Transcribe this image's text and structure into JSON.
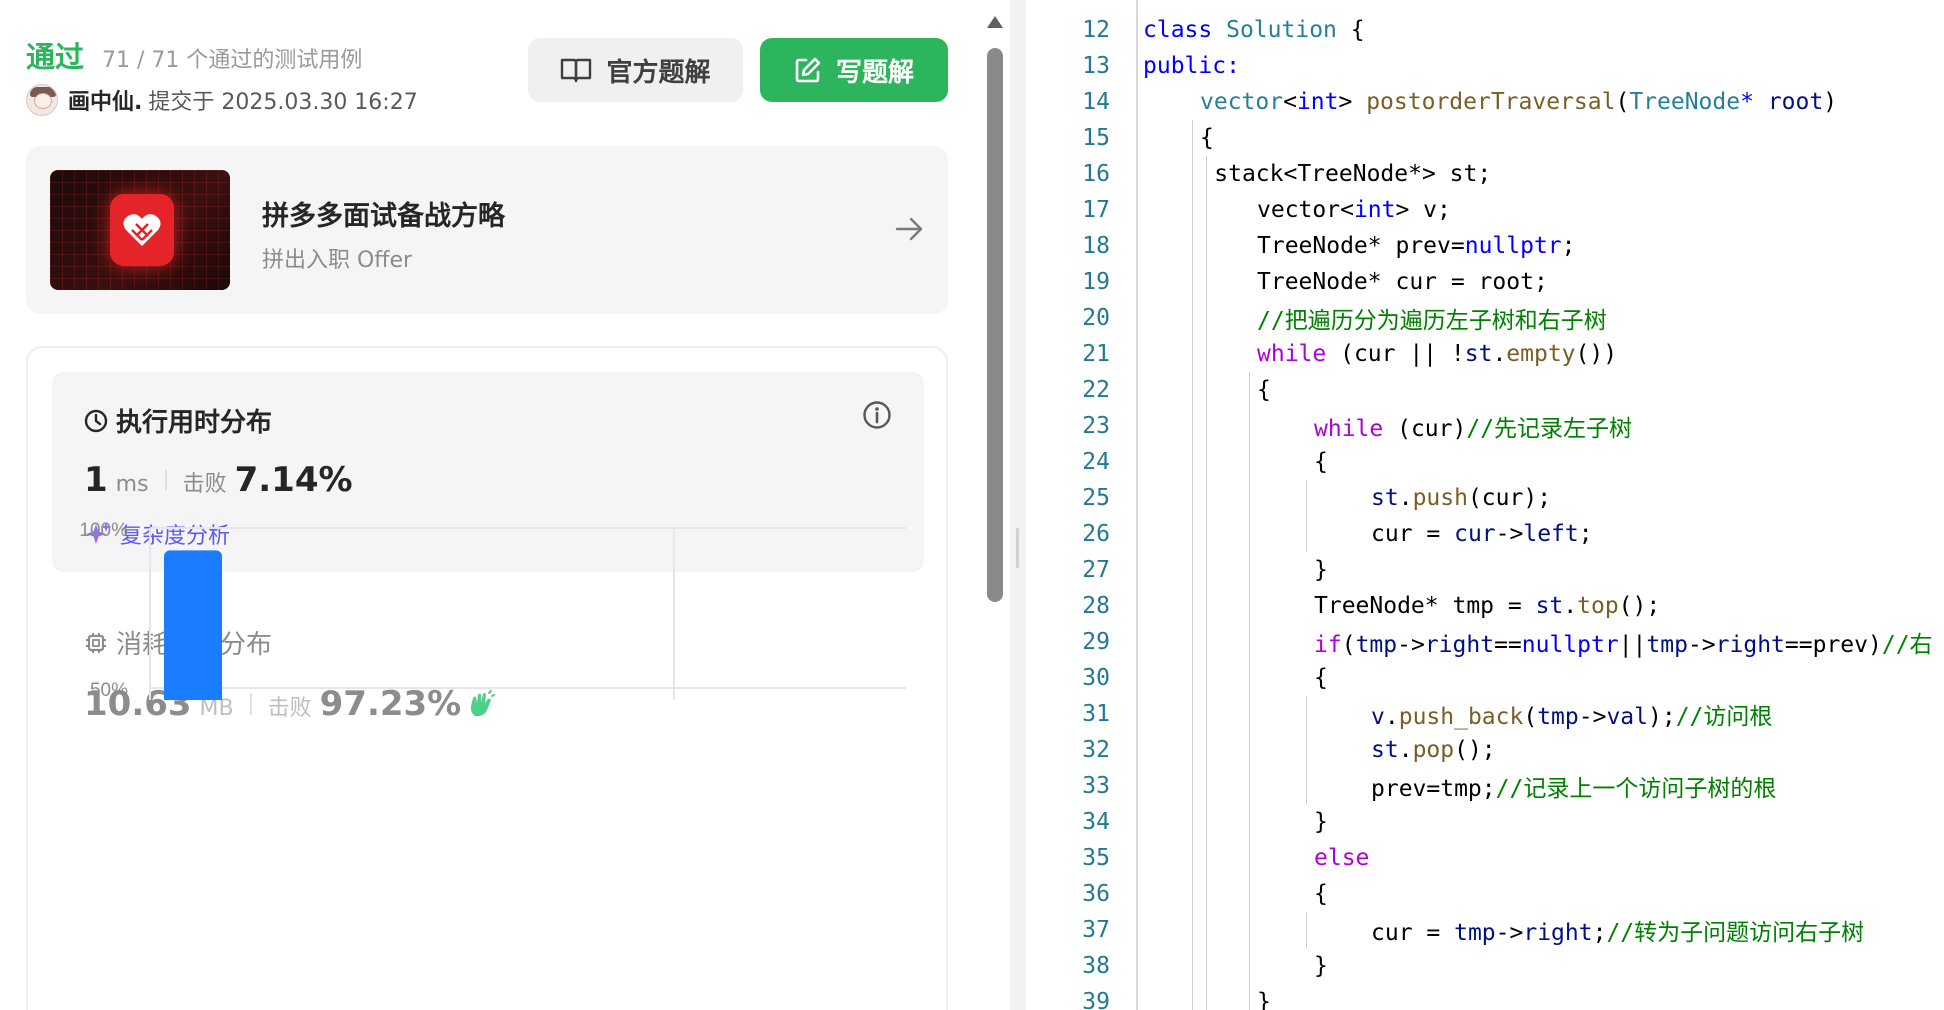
{
  "submission": {
    "status": "通过",
    "tests_passed": "71 / 71 个通过的测试用例",
    "username": "画中仙.",
    "submitted_at": "提交于 2025.03.30 16:27"
  },
  "buttons": {
    "official_solution": "官方题解",
    "write_solution": "写题解"
  },
  "banner": {
    "title": "拼多多面试备战方略",
    "subtitle": "拼出入职 Offer"
  },
  "runtime": {
    "title": "执行用时分布",
    "value": "1",
    "unit": "ms",
    "beat_label": "击败",
    "beat_pct": "7.14%",
    "complexity_link": "复杂度分析"
  },
  "memory": {
    "title": "消耗内存分布",
    "value": "10.63",
    "unit": "MB",
    "beat_label": "击败",
    "beat_pct": "97.23%"
  },
  "chart_data": {
    "type": "bar",
    "y_tick_labels": [
      "100%",
      "50%"
    ],
    "ylim": [
      50,
      100
    ],
    "grid": true,
    "values": [
      93
    ]
  },
  "colors": {
    "accent_green": "#2db55d",
    "bar_blue": "#1a7dff",
    "link_purple": "#5b5bf0"
  },
  "editor": {
    "lines": [
      {
        "n": "12",
        "indent": 0,
        "tokens": [
          [
            "k",
            "class"
          ],
          [
            "p",
            " "
          ],
          [
            "t",
            "Solution"
          ],
          [
            "p",
            " {"
          ]
        ]
      },
      {
        "n": "13",
        "indent": 0,
        "tokens": [
          [
            "k",
            "public"
          ],
          [
            "k",
            ":"
          ]
        ]
      },
      {
        "n": "14",
        "indent": 1,
        "tokens": [
          [
            "t",
            "vector"
          ],
          [
            "p",
            "<"
          ],
          [
            "k",
            "int"
          ],
          [
            "p",
            "> "
          ],
          [
            "f",
            "postorderTraversal"
          ],
          [
            "p",
            "("
          ],
          [
            "t",
            "TreeNode"
          ],
          [
            "k",
            "*"
          ],
          [
            "p",
            " "
          ],
          [
            "v",
            "root"
          ],
          [
            "p",
            ")"
          ]
        ]
      },
      {
        "n": "15",
        "indent": 1,
        "tokens": [
          [
            "p",
            "{"
          ]
        ]
      },
      {
        "n": "16",
        "indent": 1.25,
        "tokens": [
          [
            "p",
            "stack<TreeNode*> st;"
          ]
        ]
      },
      {
        "n": "17",
        "indent": 2,
        "tokens": [
          [
            "p",
            "vector<"
          ],
          [
            "k",
            "int"
          ],
          [
            "p",
            "> v;"
          ]
        ]
      },
      {
        "n": "18",
        "indent": 2,
        "tokens": [
          [
            "p",
            "TreeNode* prev="
          ],
          [
            "k",
            "nullptr"
          ],
          [
            "p",
            ";"
          ]
        ]
      },
      {
        "n": "19",
        "indent": 2,
        "tokens": [
          [
            "p",
            "TreeNode* cur = root;"
          ]
        ]
      },
      {
        "n": "20",
        "indent": 2,
        "tokens": [
          [
            "c",
            "//把遍历分为遍历左子树和右子树"
          ]
        ]
      },
      {
        "n": "21",
        "indent": 2,
        "tokens": [
          [
            "ctl",
            "while"
          ],
          [
            "p",
            " (cur || !"
          ],
          [
            "v",
            "st"
          ],
          [
            "p",
            "."
          ],
          [
            "f",
            "empty"
          ],
          [
            "p",
            "())"
          ]
        ]
      },
      {
        "n": "22",
        "indent": 2,
        "tokens": [
          [
            "p",
            "{"
          ]
        ]
      },
      {
        "n": "23",
        "indent": 3,
        "tokens": [
          [
            "ctl",
            "while"
          ],
          [
            "p",
            " (cur)"
          ],
          [
            "c",
            "//先记录左子树"
          ]
        ]
      },
      {
        "n": "24",
        "indent": 3,
        "tokens": [
          [
            "p",
            "{"
          ]
        ]
      },
      {
        "n": "25",
        "indent": 4,
        "tokens": [
          [
            "v",
            "st"
          ],
          [
            "p",
            "."
          ],
          [
            "f",
            "push"
          ],
          [
            "p",
            "(cur);"
          ]
        ]
      },
      {
        "n": "26",
        "indent": 4,
        "tokens": [
          [
            "p",
            "cur = "
          ],
          [
            "v",
            "cur"
          ],
          [
            "p",
            "->"
          ],
          [
            "v",
            "left"
          ],
          [
            "p",
            ";"
          ]
        ]
      },
      {
        "n": "27",
        "indent": 3,
        "tokens": [
          [
            "p",
            "}"
          ]
        ]
      },
      {
        "n": "28",
        "indent": 3,
        "tokens": [
          [
            "p",
            "TreeNode* tmp = "
          ],
          [
            "v",
            "st"
          ],
          [
            "p",
            "."
          ],
          [
            "f",
            "top"
          ],
          [
            "p",
            "();"
          ]
        ]
      },
      {
        "n": "29",
        "indent": 3,
        "tokens": [
          [
            "ctl",
            "if"
          ],
          [
            "p",
            "("
          ],
          [
            "v",
            "tmp"
          ],
          [
            "p",
            "->"
          ],
          [
            "v",
            "right"
          ],
          [
            "p",
            "=="
          ],
          [
            "k",
            "nullptr"
          ],
          [
            "p",
            "||"
          ],
          [
            "v",
            "tmp"
          ],
          [
            "p",
            "->"
          ],
          [
            "v",
            "right"
          ],
          [
            "p",
            "==prev)"
          ],
          [
            "c",
            "//右"
          ]
        ]
      },
      {
        "n": "30",
        "indent": 3,
        "tokens": [
          [
            "p",
            "{"
          ]
        ]
      },
      {
        "n": "31",
        "indent": 4,
        "tokens": [
          [
            "v",
            "v"
          ],
          [
            "p",
            "."
          ],
          [
            "f",
            "push_back"
          ],
          [
            "p",
            "("
          ],
          [
            "v",
            "tmp"
          ],
          [
            "p",
            "->"
          ],
          [
            "v",
            "val"
          ],
          [
            "p",
            ");"
          ],
          [
            "c",
            "//访问根"
          ]
        ]
      },
      {
        "n": "32",
        "indent": 4,
        "tokens": [
          [
            "v",
            "st"
          ],
          [
            "p",
            "."
          ],
          [
            "f",
            "pop"
          ],
          [
            "p",
            "();"
          ]
        ]
      },
      {
        "n": "33",
        "indent": 4,
        "tokens": [
          [
            "p",
            "prev=tmp;"
          ],
          [
            "c",
            "//记录上一个访问子树的根"
          ]
        ]
      },
      {
        "n": "34",
        "indent": 3,
        "tokens": [
          [
            "p",
            "}"
          ]
        ]
      },
      {
        "n": "35",
        "indent": 3,
        "tokens": [
          [
            "ctl",
            "else"
          ]
        ]
      },
      {
        "n": "36",
        "indent": 3,
        "tokens": [
          [
            "p",
            "{"
          ]
        ]
      },
      {
        "n": "37",
        "indent": 4,
        "tokens": [
          [
            "p",
            "cur = "
          ],
          [
            "v",
            "tmp"
          ],
          [
            "p",
            "->"
          ],
          [
            "v",
            "right"
          ],
          [
            "p",
            ";"
          ],
          [
            "c",
            "//转为子问题访问右子树"
          ]
        ]
      },
      {
        "n": "38",
        "indent": 3,
        "tokens": [
          [
            "p",
            "}"
          ]
        ]
      },
      {
        "n": "39",
        "indent": 2,
        "tokens": [
          [
            "p",
            "}"
          ]
        ]
      }
    ]
  }
}
